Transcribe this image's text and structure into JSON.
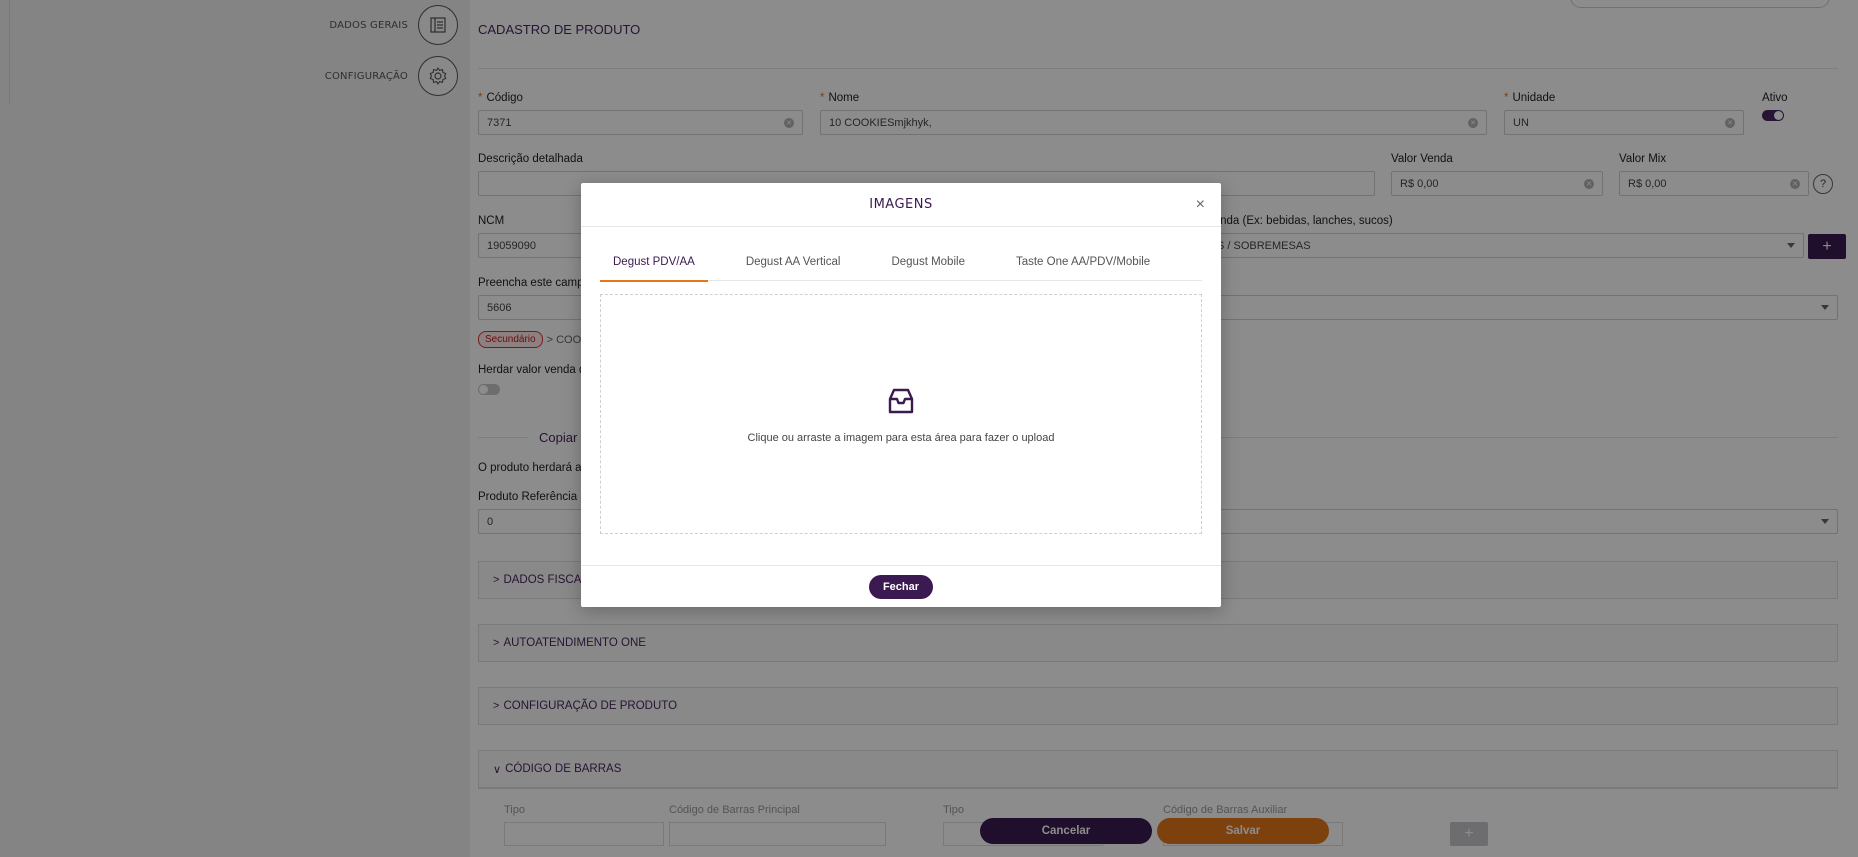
{
  "sidebar": {
    "steps": [
      {
        "label": "DADOS GERAIS",
        "icon": "list-document-icon"
      },
      {
        "label": "CONFIGURAÇÃO",
        "icon": "gear-icon"
      }
    ]
  },
  "form": {
    "title": "CADASTRO DE PRODUTO",
    "codigo": {
      "label": "Código",
      "value": "7371"
    },
    "nome": {
      "label": "Nome",
      "value": "10 COOKIESmjkhyk,"
    },
    "unidade": {
      "label": "Unidade",
      "value": "UN"
    },
    "ativo": {
      "label": "Ativo",
      "on": true
    },
    "descricao": {
      "label": "Descrição detalhada",
      "value": ""
    },
    "valor_venda": {
      "label": "Valor Venda",
      "value": "R$ 0,00"
    },
    "valor_mix": {
      "label": "Valor Mix",
      "value": "R$ 0,00"
    },
    "help": "?",
    "ncm": {
      "label": "NCM",
      "value": "19059090"
    },
    "grupo": {
      "label": "venda (Ex: bebidas, lanches, sucos)",
      "value": "S / SOBREMESAS"
    },
    "plus": "+",
    "preencha": {
      "label": "Preencha este camp",
      "value": "5606"
    },
    "badge": "Secundário",
    "badge_suffix": "> COOK",
    "herdar": {
      "label": "Herdar valor venda d",
      "on": false
    },
    "copiar_title": "Copiar",
    "herdara": "O produto herdará as",
    "produto_ref": {
      "label": "Produto Referência n",
      "value": "0"
    },
    "panels": [
      {
        "label": "DADOS FISCAIS",
        "chevron": ">"
      },
      {
        "label": "AUTOATENDIMENTO ONE",
        "chevron": ">"
      },
      {
        "label": "CONFIGURAÇÃO DE PRODUTO",
        "chevron": ">"
      },
      {
        "label": "CÓDIGO DE BARRAS",
        "chevron": "∨"
      }
    ],
    "barcode": {
      "tipo1": "Tipo",
      "principal": "Código de Barras Principal",
      "tipo2": "Tipo",
      "auxiliar": "Código de Barras Auxiliar"
    },
    "cancelar": "Cancelar",
    "salvar": "Salvar"
  },
  "modal": {
    "title": "IMAGENS",
    "close": "×",
    "tabs": [
      "Degust PDV/AA",
      "Degust AA Vertical",
      "Degust Mobile",
      "Taste One AA/PDV/Mobile"
    ],
    "active_tab": 0,
    "dropzone_text": "Clique ou arraste a imagem para esta área para fazer o upload",
    "fechar": "Fechar"
  }
}
